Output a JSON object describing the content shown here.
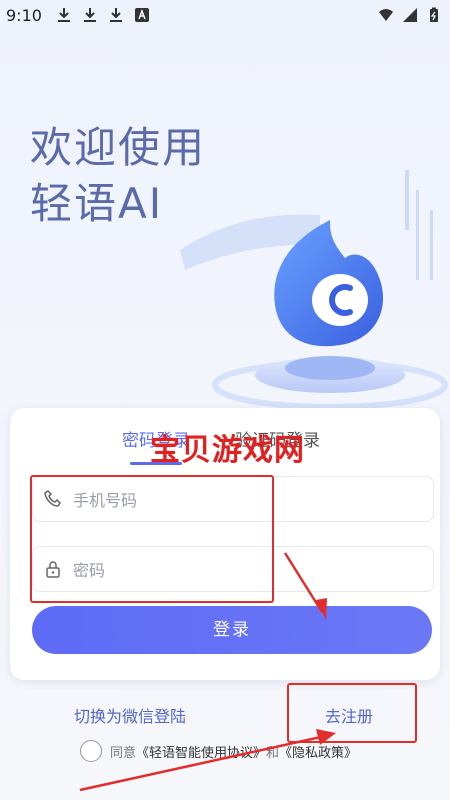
{
  "status_bar": {
    "time": "9:10",
    "left_icons": [
      "download-icon",
      "download-icon",
      "download-icon",
      "a-icon"
    ],
    "right_icons": [
      "wifi-icon",
      "signal-icon",
      "battery-icon"
    ]
  },
  "welcome": {
    "line1": "欢迎使用",
    "line2": "轻语AI"
  },
  "tabs": {
    "password_login": "密码登录",
    "code_login": "验证码登录"
  },
  "form": {
    "phone_placeholder": "手机号码",
    "password_placeholder": "密码",
    "login_button": "登录"
  },
  "links": {
    "wechat_login": "切换为微信登陆",
    "register": "去注册"
  },
  "agreement": {
    "prefix": "同意",
    "terms": "《轻语智能使用协议》",
    "and": "和",
    "privacy": "《隐私政策》"
  },
  "watermark": "宝贝游戏网",
  "colors": {
    "accent": "#5b6cf0",
    "annotation": "#e32d2d"
  }
}
